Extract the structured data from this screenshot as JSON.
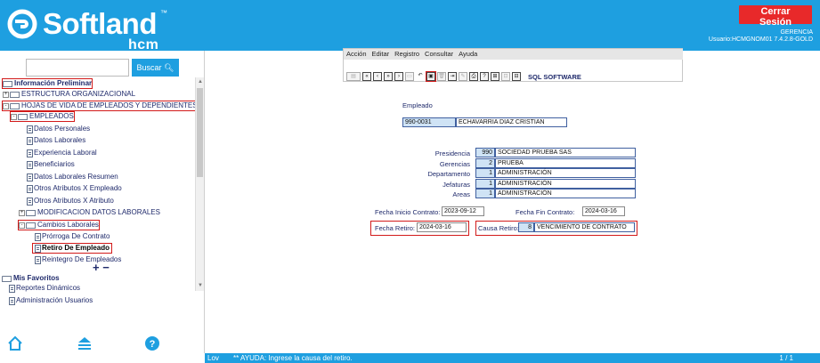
{
  "header": {
    "logo_word": "Softland",
    "logo_tm": "™",
    "logo_sub": "hcm",
    "logout_label": "Cerrar Sesión",
    "company": "GERENCIA",
    "user_line": "Usuario:HCMGNOM01 7.4.2.8-GOLD",
    "bg_color": "#1e9fe0",
    "logout_color": "#e8292a"
  },
  "sidebar": {
    "search_label": "Buscar",
    "search_icon": "magnifier-icon",
    "tree": [
      {
        "label": "Información Preliminar",
        "level": 0,
        "icon": "folder-open",
        "highlight": true
      },
      {
        "label": "ESTRUCTURA ORGANIZACIONAL",
        "level": 0,
        "icon": "folder",
        "toggle": "+"
      },
      {
        "label": "HOJAS DE VIDA DE EMPLEADOS Y DEPENDIENTES",
        "level": 0,
        "icon": "folder-open",
        "toggle": "-",
        "highlight": true
      },
      {
        "label": "EMPLEADOS",
        "level": 1,
        "icon": "folder-open",
        "toggle": "-",
        "highlight": true
      },
      {
        "label": "Datos Personales",
        "level": 2,
        "icon": "doc"
      },
      {
        "label": "Datos Laborales",
        "level": 2,
        "icon": "doc"
      },
      {
        "label": "Experiencia Laboral",
        "level": 2,
        "icon": "doc"
      },
      {
        "label": "Beneficiarios",
        "level": 2,
        "icon": "doc"
      },
      {
        "label": "Datos Laborales Resumen",
        "level": 2,
        "icon": "doc"
      },
      {
        "label": "Otros Atributos X Empleado",
        "level": 2,
        "icon": "doc"
      },
      {
        "label": "Otros Atributos X Atributo",
        "level": 2,
        "icon": "doc"
      },
      {
        "label": "MODIFICACION DATOS LABORALES",
        "level": 2,
        "icon": "folder",
        "toggle": "+"
      },
      {
        "label": "Cambios Laborales",
        "level": 2,
        "icon": "folder-open",
        "toggle": "-",
        "highlight": true
      },
      {
        "label": "Prórroga De Contrato",
        "level": 3,
        "icon": "doc"
      },
      {
        "label": "Retiro De Empleado",
        "level": 3,
        "icon": "doc",
        "highlight": true,
        "bold": true
      },
      {
        "label": "Reintegro De Empleados",
        "level": 3,
        "icon": "doc"
      }
    ],
    "expand_collapse": "+ −",
    "favorites_title": "Mis Favoritos",
    "favorites": [
      "Reportes Dinámicos",
      "Administración Usuarios"
    ],
    "bottom_icons": [
      "home-icon",
      "layers-icon",
      "help-icon"
    ]
  },
  "form": {
    "menus": [
      "Acción",
      "Editar",
      "Registro",
      "Consultar",
      "Ayuda"
    ],
    "toolbar_label": "SQL SOFTWARE",
    "section_title": "Empleado",
    "employee_id": "990-0031",
    "employee_name": "ECHAVARRIA DIAZ CRISTIAN",
    "org": [
      {
        "label": "Presidencia",
        "code": "990",
        "desc": "SOCIEDAD  PRUEBA SAS"
      },
      {
        "label": "Gerencias",
        "code": "2",
        "desc": "PRUEBA"
      },
      {
        "label": "Departamento",
        "code": "1",
        "desc": "ADMINISTRACIÓN"
      },
      {
        "label": "Jefaturas",
        "code": "1",
        "desc": "ADMINISTRACIÓN"
      },
      {
        "label": "Areas",
        "code": "1",
        "desc": "ADMINISTRACIÓN"
      }
    ],
    "start_label": "Fecha Inicio Contrato:",
    "start_value": "2023-09-12",
    "end_label": "Fecha Fin Contrato:",
    "end_value": "2024-03-16",
    "retiro_label": "Fecha Retiro:",
    "retiro_value": "2024-03-16",
    "causa_label": "Causa Retiro:",
    "causa_code": "8",
    "causa_desc": "VENCIMIENTO DE CONTRATO"
  },
  "status": {
    "lov": "Lov",
    "help": "** AYUDA: Ingrese la causa del retiro.",
    "page": "1 / 1"
  }
}
